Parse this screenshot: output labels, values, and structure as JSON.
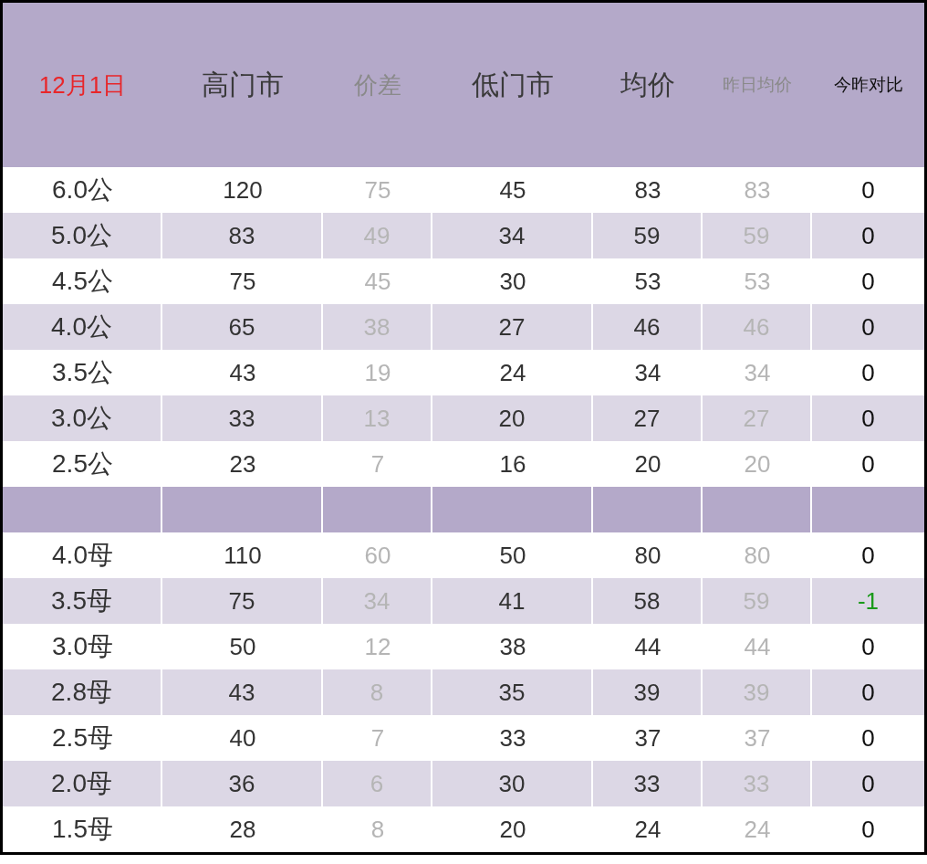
{
  "table": {
    "columns": [
      {
        "label": "12月1日",
        "kind": "date"
      },
      {
        "label": "高门市",
        "kind": "main"
      },
      {
        "label": "价差",
        "kind": "muted"
      },
      {
        "label": "低门市",
        "kind": "main"
      },
      {
        "label": "均价",
        "kind": "main"
      },
      {
        "label": "昨日均价",
        "kind": "small-muted"
      },
      {
        "label": "今昨对比",
        "kind": "small"
      }
    ],
    "groups": [
      {
        "rows": [
          {
            "cells": [
              "6.0公",
              "120",
              "75",
              "45",
              "83",
              "83",
              "0"
            ],
            "negative": false
          },
          {
            "cells": [
              "5.0公",
              "83",
              "49",
              "34",
              "59",
              "59",
              "0"
            ],
            "negative": false
          },
          {
            "cells": [
              "4.5公",
              "75",
              "45",
              "30",
              "53",
              "53",
              "0"
            ],
            "negative": false
          },
          {
            "cells": [
              "4.0公",
              "65",
              "38",
              "27",
              "46",
              "46",
              "0"
            ],
            "negative": false
          },
          {
            "cells": [
              "3.5公",
              "43",
              "19",
              "24",
              "34",
              "34",
              "0"
            ],
            "negative": false
          },
          {
            "cells": [
              "3.0公",
              "33",
              "13",
              "20",
              "27",
              "27",
              "0"
            ],
            "negative": false
          },
          {
            "cells": [
              "2.5公",
              "23",
              "7",
              "16",
              "20",
              "20",
              "0"
            ],
            "negative": false
          }
        ]
      },
      {
        "rows": [
          {
            "cells": [
              "4.0母",
              "110",
              "60",
              "50",
              "80",
              "80",
              "0"
            ],
            "negative": false
          },
          {
            "cells": [
              "3.5母",
              "75",
              "34",
              "41",
              "58",
              "59",
              "-1"
            ],
            "negative": true
          },
          {
            "cells": [
              "3.0母",
              "50",
              "12",
              "38",
              "44",
              "44",
              "0"
            ],
            "negative": false
          },
          {
            "cells": [
              "2.8母",
              "43",
              "8",
              "35",
              "39",
              "39",
              "0"
            ],
            "negative": false
          },
          {
            "cells": [
              "2.5母",
              "40",
              "7",
              "33",
              "37",
              "37",
              "0"
            ],
            "negative": false
          },
          {
            "cells": [
              "2.0母",
              "36",
              "6",
              "30",
              "33",
              "33",
              "0"
            ],
            "negative": false
          },
          {
            "cells": [
              "1.5母",
              "28",
              "8",
              "20",
              "24",
              "24",
              "0"
            ],
            "negative": false
          }
        ]
      }
    ]
  }
}
